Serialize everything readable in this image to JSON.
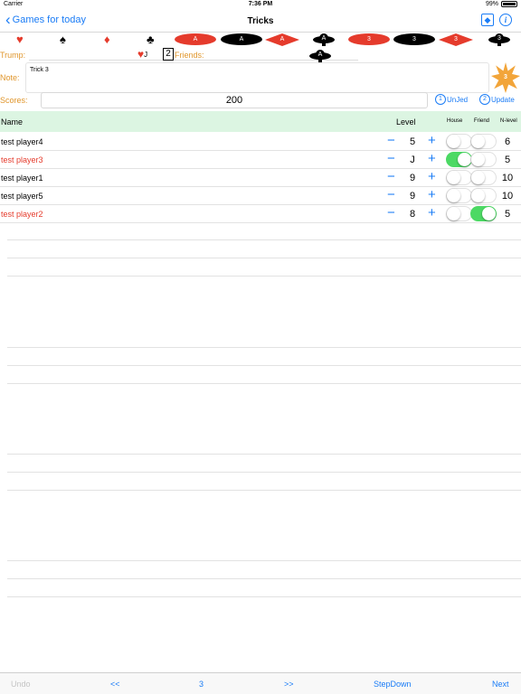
{
  "status_bar": {
    "carrier": "Carrier",
    "time": "7:36 PM",
    "battery": "99%"
  },
  "nav": {
    "back_label": "Games for today",
    "title": "Tricks",
    "info_icon": "i"
  },
  "suits": [
    "♥",
    "♠",
    "♦",
    "♣"
  ],
  "trump_cards": {
    "ace": "A",
    "three": "3"
  },
  "trump": {
    "label": "Trump:",
    "heart": "♥",
    "value": "J",
    "friends_count": "2",
    "friends_label": "Friends:"
  },
  "note": {
    "label": "Note:",
    "value": "Trick 3",
    "badge": "3"
  },
  "scores": {
    "label": "Scores:",
    "value": "200",
    "btn1_num": "1",
    "btn1_label": "UnJed",
    "btn2_num": "2",
    "btn2_label": "Update"
  },
  "table": {
    "headers": {
      "name": "Name",
      "level": "Level",
      "house": "House",
      "friend": "Friend",
      "nlevel": "N-level"
    },
    "minus": "−",
    "plus": "+",
    "rows": [
      {
        "name": "test player4",
        "level": "5",
        "nlevel": "6",
        "house": false,
        "friend": false,
        "highlight": false
      },
      {
        "name": "test player3",
        "level": "J",
        "nlevel": "5",
        "house": true,
        "friend": false,
        "highlight": true
      },
      {
        "name": "test player1",
        "level": "9",
        "nlevel": "10",
        "house": false,
        "friend": false,
        "highlight": false
      },
      {
        "name": "test player5",
        "level": "9",
        "nlevel": "10",
        "house": false,
        "friend": false,
        "highlight": false
      },
      {
        "name": "test player2",
        "level": "8",
        "nlevel": "5",
        "house": false,
        "friend": true,
        "highlight": true
      }
    ]
  },
  "bottom": {
    "undo": "Undo",
    "prev": "<<",
    "page": "3",
    "next_page": ">>",
    "stepdown": "StepDown",
    "next": "Next"
  },
  "colors": {
    "accent": "#1a7cf6",
    "red": "#e53b2c",
    "orange": "#e0962c",
    "header_bg": "#dcf5e2",
    "toggle_on": "#4cd964"
  }
}
